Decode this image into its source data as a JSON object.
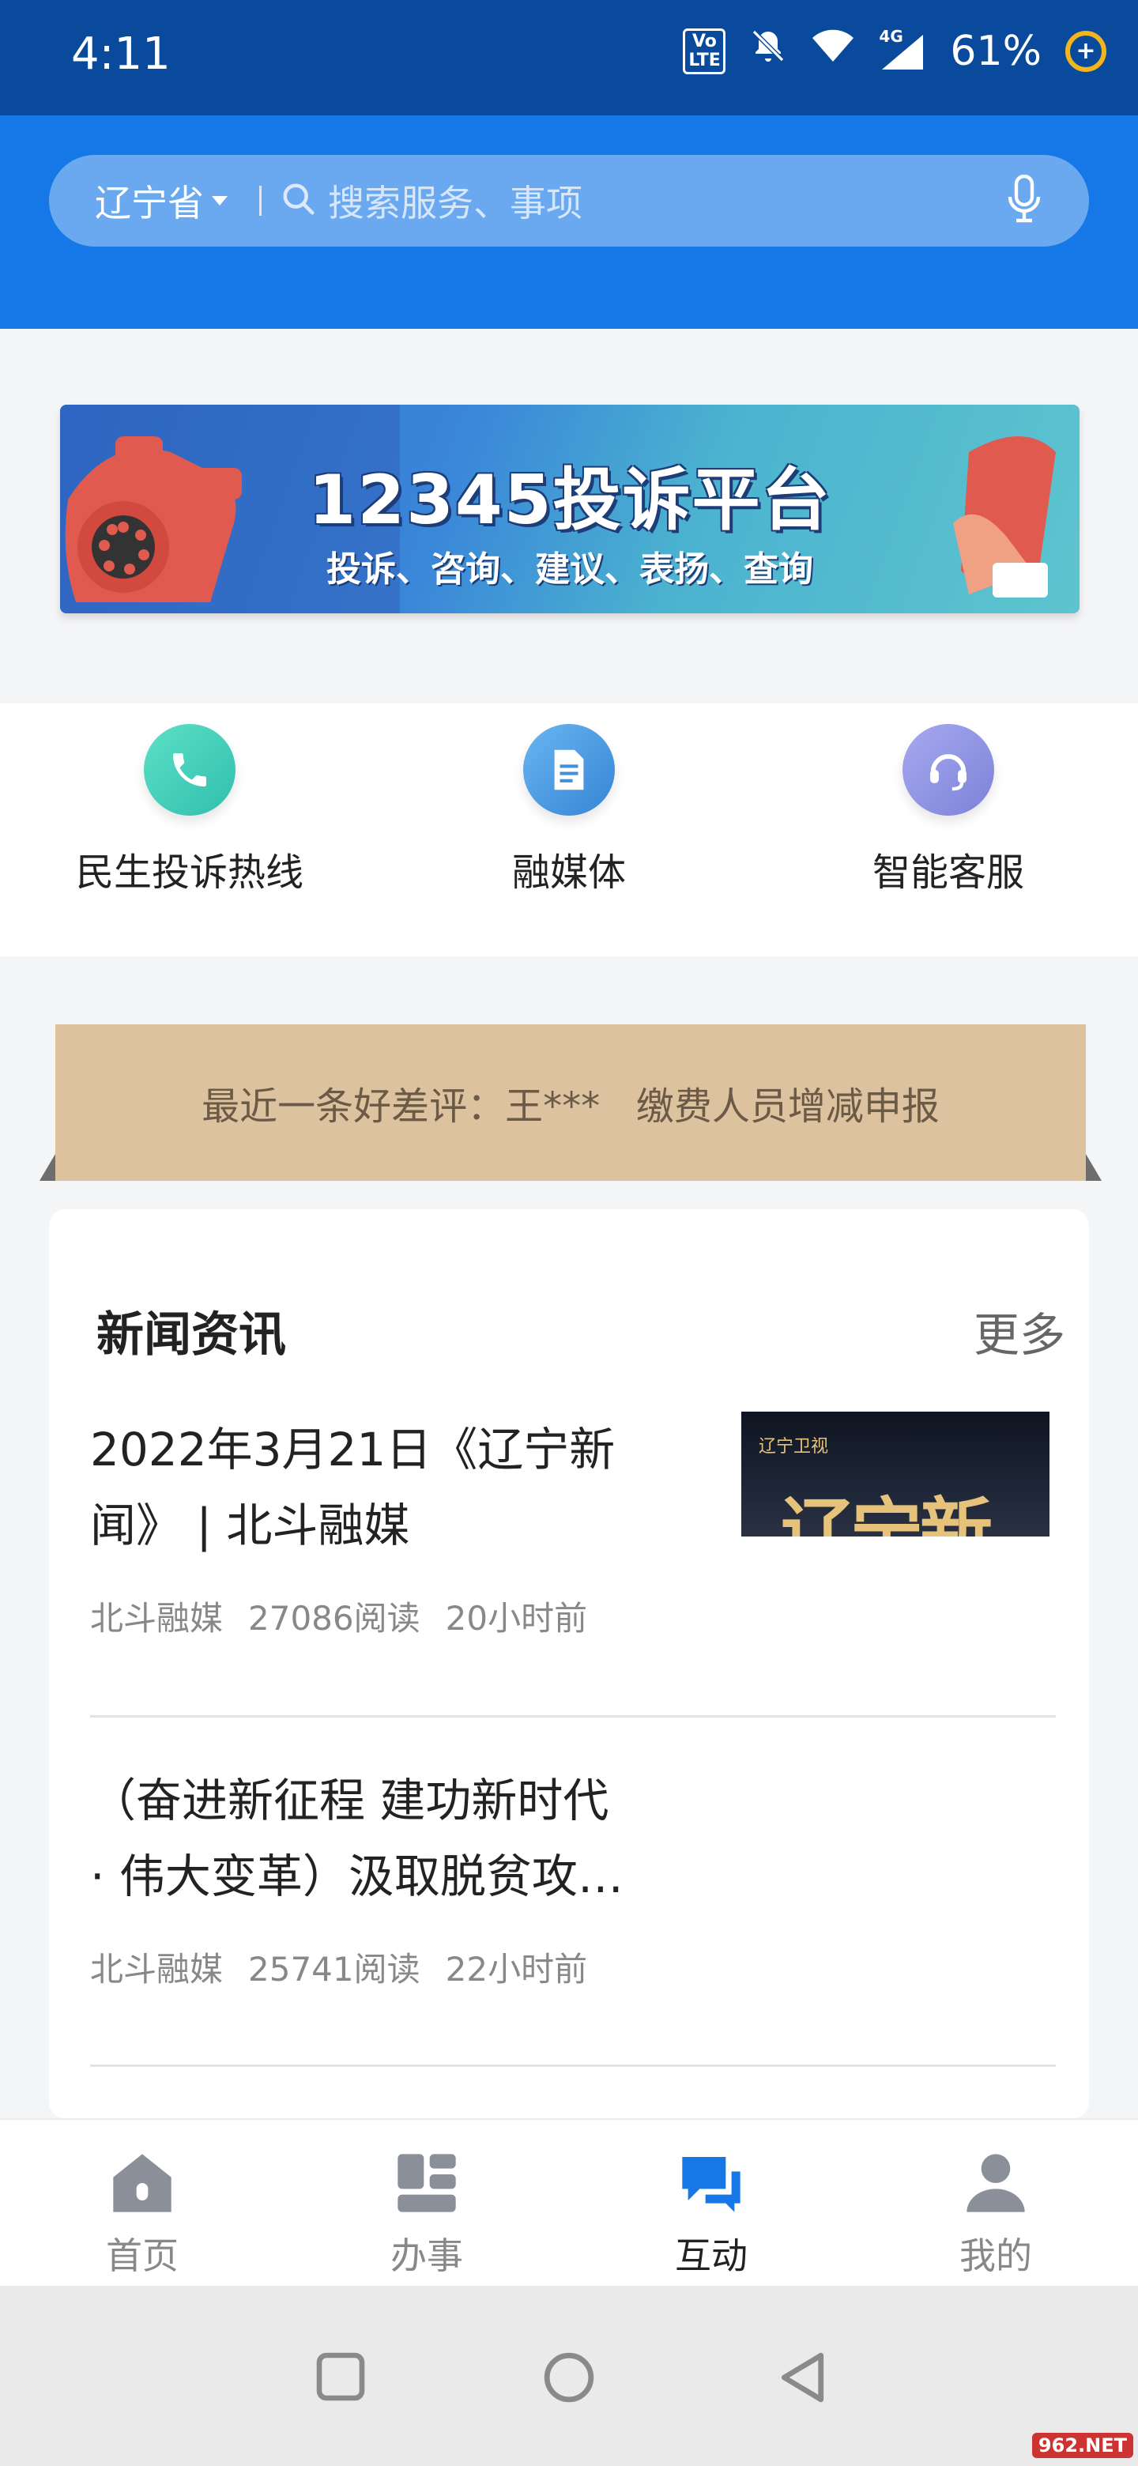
{
  "status_bar": {
    "time": "4:11",
    "volte_badge": "Vo LTE",
    "network": "4G",
    "battery": "61%",
    "battery_saver": "+"
  },
  "header": {
    "region": "辽宁省",
    "search_placeholder": "搜索服务、事项"
  },
  "banner": {
    "title": "12345投诉平台",
    "subtitle": "投诉、咨询、建议、表扬、查询"
  },
  "quick_actions": [
    {
      "label": "民生投诉热线",
      "icon": "phone-icon",
      "color": "#3cc7b4"
    },
    {
      "label": "融媒体",
      "icon": "document-icon",
      "color": "#3f8fda"
    },
    {
      "label": "智能客服",
      "icon": "headset-icon",
      "color": "#8b8fe0"
    }
  ],
  "review_strip": {
    "text": "最近一条好差评：王***   缴费人员增减申报"
  },
  "news": {
    "title": "新闻资讯",
    "more": "更多",
    "articles": [
      {
        "title_line1": "2022年3月21日《辽宁新",
        "title_line2": "闻》 | 北斗融媒",
        "source": "北斗融媒",
        "reads": "27086阅读",
        "time": "20小时前",
        "thumbnail_text": "辽宁新闻",
        "thumbnail_logo": "辽宁卫视"
      },
      {
        "title_line1": "（奋进新征程 建功新时代",
        "title_line2": "· 伟大变革）汲取脱贫攻…",
        "source": "北斗融媒",
        "reads": "25741阅读",
        "time": "22小时前"
      }
    ]
  },
  "bottom_nav": [
    {
      "label": "首页",
      "icon": "home-icon"
    },
    {
      "label": "办事",
      "icon": "services-icon"
    },
    {
      "label": "互动",
      "icon": "chat-icon",
      "active": true
    },
    {
      "label": "我的",
      "icon": "profile-icon"
    }
  ],
  "colors": {
    "header_blue": "#1677e6",
    "status_bar": "#0a4a9c",
    "active_nav": "#1677e6",
    "inactive_nav": "#8a8f99"
  },
  "watermark": "962.NET"
}
